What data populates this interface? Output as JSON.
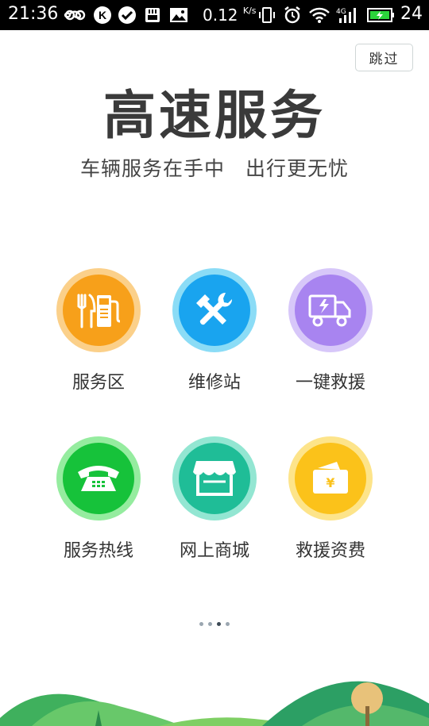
{
  "status_bar": {
    "time": "21:36",
    "speed": "0.12",
    "speed_unit": "K/s",
    "network": "4G",
    "battery": "24"
  },
  "skip_label": "跳过",
  "title": "高速服务",
  "subtitle": "车辆服务在手中　出行更无忧",
  "services": [
    {
      "label": "服务区",
      "icon": "gas-station-restaurant-icon",
      "color": "#f7a01a",
      "ring": "#fbd08a"
    },
    {
      "label": "维修站",
      "icon": "wrench-hammer-icon",
      "color": "#19a4ef",
      "ring": "#8bdcf6"
    },
    {
      "label": "一键救援",
      "icon": "tow-truck-icon",
      "color": "#a884f0",
      "ring": "#d7c7f9"
    },
    {
      "label": "服务热线",
      "icon": "telephone-icon",
      "color": "#16c23a",
      "ring": "#95ec9f"
    },
    {
      "label": "网上商城",
      "icon": "store-icon",
      "color": "#1fbd97",
      "ring": "#93e6d2"
    },
    {
      "label": "救援资费",
      "icon": "yuan-wallet-icon",
      "color": "#fbc21a",
      "ring": "#fde48a"
    }
  ],
  "pager": {
    "count": 4,
    "active": 2
  },
  "colors": {
    "title": "#3a3a3a",
    "subtitle": "#444444"
  }
}
